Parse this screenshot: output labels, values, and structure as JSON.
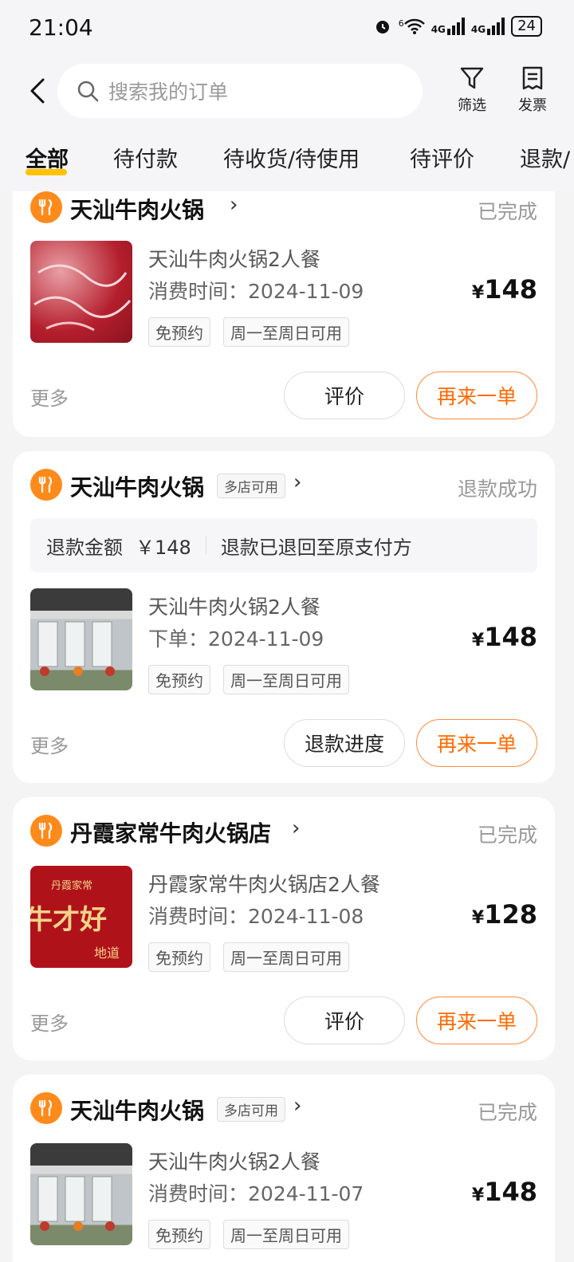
{
  "status_bar": {
    "time": "21:04",
    "net_wifi": "6",
    "net_a": "4G",
    "net_b": "4G",
    "battery": "24"
  },
  "header": {
    "search_placeholder": "搜索我的订单",
    "filter_label": "筛选",
    "invoice_label": "发票"
  },
  "tabs": [
    "全部",
    "待付款",
    "待收货/待使用",
    "待评价",
    "退款/"
  ],
  "orders": [
    {
      "store": "天汕牛肉火锅",
      "status": "已完成",
      "product": "天汕牛肉火锅2人餐",
      "time_label": "消费时间：",
      "time": "2024-11-09",
      "tags": [
        "免预约",
        "周一至周日可用"
      ],
      "currency": "¥",
      "price": "148",
      "more": "更多",
      "btn1": "评价",
      "btn2": "再来一单"
    },
    {
      "store": "天汕牛肉火锅",
      "badge": "多店可用",
      "status": "退款成功",
      "refund_label": "退款金额",
      "refund_amount": "￥148",
      "refund_note": "退款已退回至原支付方",
      "product": "天汕牛肉火锅2人餐",
      "time_label": "下单：",
      "time": "2024-11-09",
      "tags": [
        "免预约",
        "周一至周日可用"
      ],
      "currency": "¥",
      "price": "148",
      "more": "更多",
      "btn1": "退款进度",
      "btn2": "再来一单"
    },
    {
      "store": "丹霞家常牛肉火锅店",
      "status": "已完成",
      "product": "丹霞家常牛肉火锅店2人餐",
      "time_label": "消费时间：",
      "time": "2024-11-08",
      "tags": [
        "免预约",
        "周一至周日可用"
      ],
      "currency": "¥",
      "price": "128",
      "more": "更多",
      "btn1": "评价",
      "btn2": "再来一单",
      "thumb_text_1": "丹霞家常",
      "thumb_text_2": "牛才好",
      "thumb_text_3": "地道"
    },
    {
      "store": "天汕牛肉火锅",
      "badge": "多店可用",
      "status": "已完成",
      "product": "天汕牛肉火锅2人餐",
      "time_label": "消费时间：",
      "time": "2024-11-07",
      "tags": [
        "免预约",
        "周一至周日可用"
      ],
      "currency": "¥",
      "price": "148"
    }
  ],
  "colors": {
    "accent": "#ff6a00",
    "store_icon": "#ff8a1c",
    "tab_underline": "#ffc300"
  },
  "icons": [
    "back-arrow-icon",
    "search-icon",
    "filter-icon",
    "invoice-icon",
    "store-icon",
    "chevron-right-icon"
  ]
}
